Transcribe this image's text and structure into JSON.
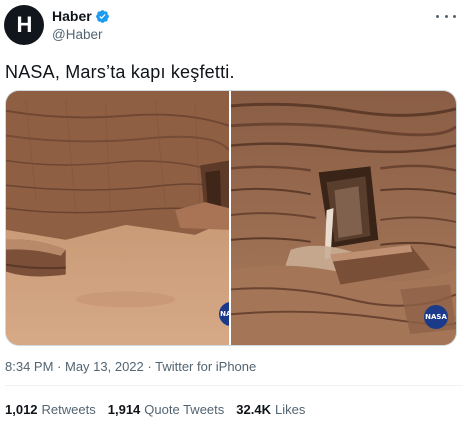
{
  "author": {
    "avatar_letter": "H",
    "display_name": "Haber",
    "handle": "@Haber",
    "verified": true
  },
  "tweet": {
    "text": "NASA, Mars’ta kapı keşfetti."
  },
  "media": {
    "images": [
      {
        "subject": "mars-rock-landscape",
        "logo_text": "NASA"
      },
      {
        "subject": "mars-rock-doorway-closeup",
        "logo_text": "NASA"
      }
    ]
  },
  "meta": {
    "time": "8:34 PM",
    "separator_1": " · ",
    "date": "May 13, 2022",
    "separator_2": " · ",
    "source": "Twitter for iPhone"
  },
  "stats": {
    "retweets_count": "1,012",
    "retweets_label": "Retweets",
    "quotes_count": "1,914",
    "quotes_label": "Quote Tweets",
    "likes_count": "32.4K",
    "likes_label": "Likes"
  },
  "colors": {
    "text_primary": "#0f1419",
    "text_secondary": "#536471",
    "verified_blue": "#1d9bf0",
    "avatar_bg": "#11161d",
    "nasa_blue": "#1b3a8a"
  }
}
